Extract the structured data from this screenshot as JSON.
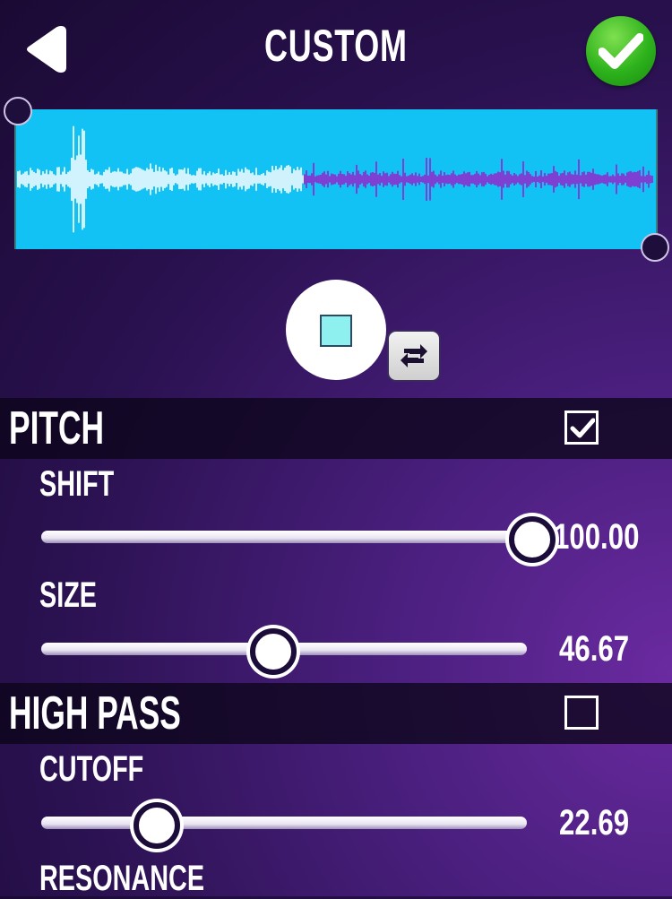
{
  "header": {
    "title": "CUSTOM",
    "back_icon": "back-triangle-icon",
    "confirm_icon": "checkmark-icon",
    "confirm_color": "#2db21c"
  },
  "waveform": {
    "background_color": "#12c2f5",
    "played_color": "#ffffff",
    "remaining_color": "#9a1fc9"
  },
  "playback": {
    "play_stop_icon": "stop-square-icon",
    "loop_icon": "repeat-icon"
  },
  "pitch": {
    "title": "PITCH",
    "enabled": true,
    "shift": {
      "label": "SHIFT",
      "value": "100.00",
      "fraction": 1.0
    },
    "size": {
      "label": "SIZE",
      "value": "46.67",
      "fraction": 0.4667
    }
  },
  "high_pass": {
    "title": "HIGH PASS",
    "enabled": false,
    "cutoff": {
      "label": "CUTOFF",
      "value": "22.69",
      "fraction": 0.2269
    },
    "resonance": {
      "label": "RESONANCE"
    }
  }
}
